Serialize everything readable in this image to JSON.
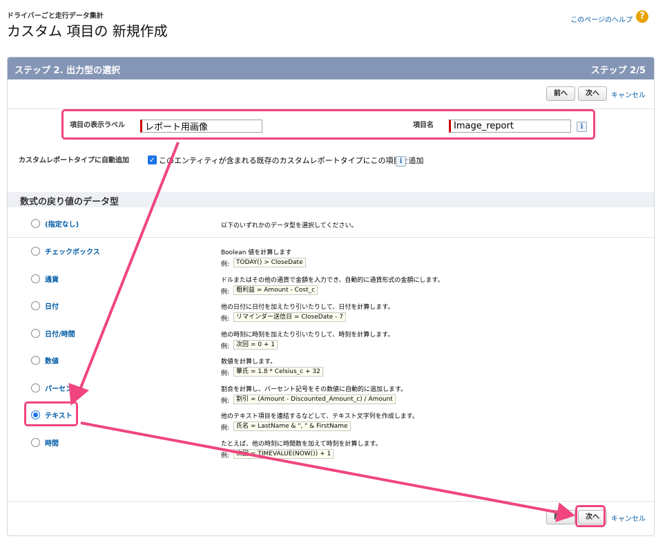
{
  "header": {
    "breadcrumb": "ドライバーごと走行データ集計",
    "title": "カスタム 項目の 新規作成",
    "help_link": "このページのヘルプ",
    "help_icon": "question-icon"
  },
  "step": {
    "title": "ステップ 2. 出力型の選択",
    "counter": "ステップ 2/5"
  },
  "buttons": {
    "prev": "前へ",
    "next": "次へ",
    "cancel": "キャンセル"
  },
  "fields": {
    "display_label_label": "項目の表示ラベル",
    "display_label_value": "レポート用画像",
    "field_name_label": "項目名",
    "field_name_value": "Image_report",
    "info_icon": "i",
    "auto_add_label": "カスタムレポートタイプに自動追加",
    "auto_add_text": "このエンティティが含まれる既存のカスタムレポートタイプにこの項目を追加",
    "auto_add_checked": true
  },
  "section": {
    "title": "数式の戻り値のデータ型"
  },
  "example_prefix": "例:",
  "types": [
    {
      "label": "(指定なし)",
      "desc": "以下のいずれかのデータ型を選択してください。",
      "example": "",
      "checked": false
    },
    {
      "label": "チェックボックス",
      "desc": "Boolean 値を計算します",
      "example": "TODAY() > CloseDate",
      "checked": false
    },
    {
      "label": "通貨",
      "desc": "ドルまたはその他の通貨で金額を入力でき、自動的に通貨形式の金額にします。",
      "example": "粗利益 = Amount - Cost_c",
      "checked": false
    },
    {
      "label": "日付",
      "desc": "他の日付に日付を加えたり引いたりして、日付を計算します。",
      "example": "リマインダー送信日 = CloseDate - 7",
      "checked": false
    },
    {
      "label": "日付/時間",
      "desc": "他の時刻に時刻を加えたり引いたりして、時刻を計算します。",
      "example": "次回 = 0 + 1",
      "checked": false
    },
    {
      "label": "数値",
      "desc": "数値を計算します。",
      "example": "華氏 = 1.8 * Celsius_c + 32",
      "checked": false
    },
    {
      "label": "パーセント",
      "desc": "割合を計算し、パーセント記号をその数値に自動的に追加します。",
      "example": "割引 = (Amount - Discounted_Amount_c) / Amount",
      "checked": false
    },
    {
      "label": "テキスト",
      "desc": "他のテキスト項目を連結するなどして、テキスト文字列を作成します。",
      "example": "氏名 = LastName & \", \" & FirstName",
      "checked": true
    },
    {
      "label": "時間",
      "desc": "たとえば、他の時刻に時間数を加えて時刻を計算します。",
      "example": "次回 = TIMEVALUE(NOW()) + 1",
      "checked": false
    }
  ],
  "colors": {
    "header_band": "#8595b6",
    "link": "#015ba7",
    "highlight": "#f0457e",
    "required_bar": "#cc0000"
  }
}
